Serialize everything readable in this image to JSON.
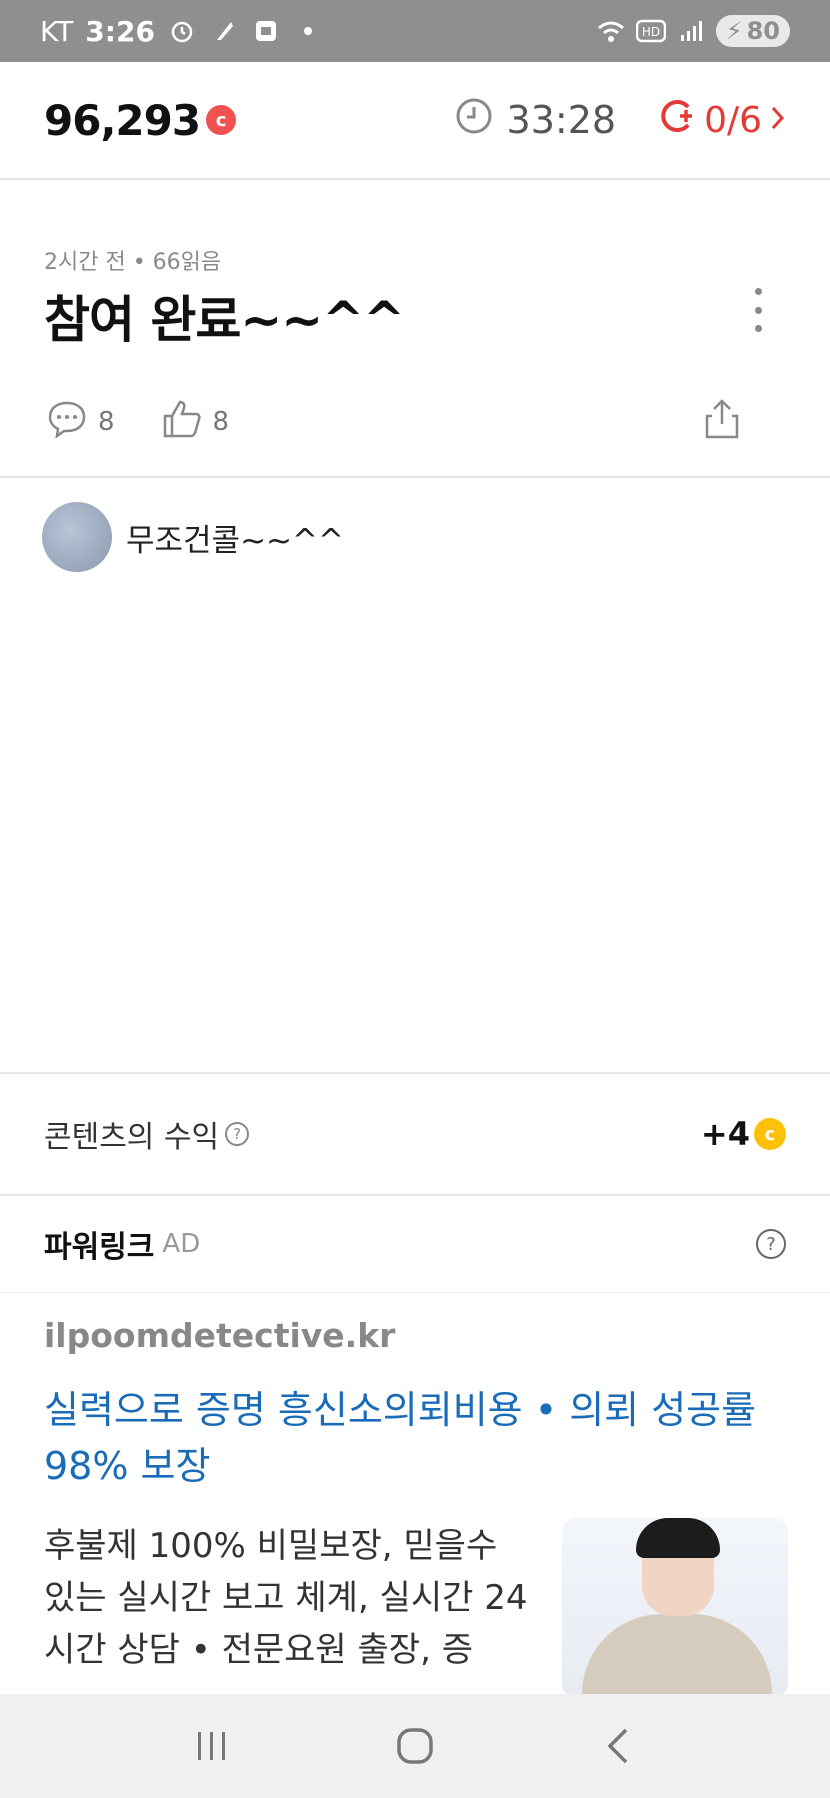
{
  "status_bar": {
    "carrier": "KT",
    "time": "3:26",
    "battery": "80"
  },
  "top_bar": {
    "points": "96,293",
    "coin_glyph": "c",
    "timer": "33:28",
    "mission": "0/6"
  },
  "post": {
    "meta": "2시간 전 • 66읽음",
    "title": "참여 완료~~^^",
    "comment_count": "8",
    "like_count": "8"
  },
  "comment": {
    "text": "무조건콜~~^^"
  },
  "revenue": {
    "label": "콘텐츠의 수익",
    "value": "+4",
    "coin_glyph": "c"
  },
  "power_link": {
    "title": "파워링크",
    "ad_badge": "AD",
    "domain": "ilpoomdetective.kr",
    "headline": "실력으로 증명 흥신소의뢰비용 • 의뢰 성공률 98% 보장",
    "description": "후불제 100% 비밀보장, 믿을수 있는 실시간 보고 체계, 실시간 24시간 상담 • 전문요원 출장, 증"
  },
  "colors": {
    "accent_red": "#e53935",
    "link_blue": "#1a6bb8",
    "coin_yellow": "#ffc107"
  }
}
